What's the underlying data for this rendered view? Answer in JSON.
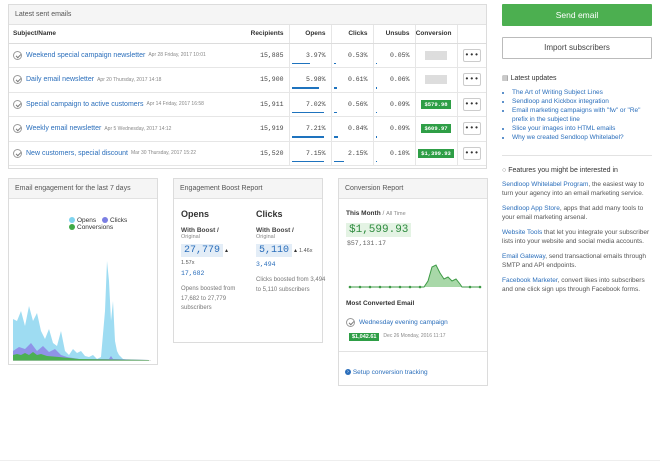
{
  "sent_panel": {
    "title": "Latest sent emails",
    "headers": [
      "Subject/Name",
      "Recipients",
      "Opens",
      "Clicks",
      "Unsubs",
      "Conversion"
    ],
    "rows": [
      {
        "name": "Weekend special campaign newsletter",
        "date": "Apr 28 Friday, 2017 10:01",
        "recipients": "15,885",
        "opens": "3.97%",
        "clicks": "0.53%",
        "unsubs": "0.05%",
        "conversion": "$0.00",
        "conv_zero": true,
        "opens_pct": 0.0397,
        "clicks_pct": 0.0053,
        "unsubs_pct": 0.0005
      },
      {
        "name": "Daily email newsletter",
        "date": "Apr 20 Thursday, 2017 14:18",
        "recipients": "15,900",
        "opens": "5.98%",
        "clicks": "0.61%",
        "unsubs": "0.06%",
        "conversion": "$0.00",
        "conv_zero": true,
        "opens_pct": 0.0598,
        "clicks_pct": 0.0061,
        "unsubs_pct": 0.0006
      },
      {
        "name": "Special campaign to active customers",
        "date": "Apr 14 Friday, 2017 16:58",
        "recipients": "15,911",
        "opens": "7.02%",
        "clicks": "0.56%",
        "unsubs": "0.09%",
        "conversion": "$579.98",
        "conv_zero": false,
        "opens_pct": 0.0702,
        "clicks_pct": 0.0056,
        "unsubs_pct": 0.0009
      },
      {
        "name": "Weekly email newsletter",
        "date": "Apr 5 Wednesday, 2017 14:12",
        "recipients": "15,919",
        "opens": "7.21%",
        "clicks": "0.84%",
        "unsubs": "0.09%",
        "conversion": "$609.97",
        "conv_zero": false,
        "opens_pct": 0.0721,
        "clicks_pct": 0.0084,
        "unsubs_pct": 0.0009
      },
      {
        "name": "New customers, special discount",
        "date": "Mar 30 Thursday, 2017 15:22",
        "recipients": "15,520",
        "opens": "7.15%",
        "clicks": "2.15%",
        "unsubs": "0.10%",
        "conversion": "$1,399.93",
        "conv_zero": false,
        "opens_pct": 0.0715,
        "clicks_pct": 0.0215,
        "unsubs_pct": 0.001
      }
    ],
    "more_label": "•••"
  },
  "engagement": {
    "title": "Email engagement for the last 7 days",
    "legend": {
      "opens": "Opens",
      "clicks": "Clicks",
      "conversions": "Conversions"
    },
    "colors": {
      "opens": "#7fd4ef",
      "clicks": "#7b7fe3",
      "conversions": "#3faa46"
    }
  },
  "boost": {
    "title": "Engagement Boost Report",
    "opens": {
      "title": "Opens",
      "with_boost": "With Boost",
      "original": "Original",
      "value": "27,779",
      "multiplier": "1.57x",
      "orig_value": "17,682",
      "note": "Opens boosted from 17,682 to 27,779 subscribers"
    },
    "clicks": {
      "title": "Clicks",
      "with_boost": "With Boost",
      "original": "Original",
      "value": "5,110",
      "multiplier": "1.46x",
      "orig_value": "3,494",
      "note": "Clicks boosted from 3,494 to 5,110 subscribers"
    }
  },
  "conversion": {
    "title": "Conversion Report",
    "this_month": "This Month",
    "all_time": "All Time",
    "amount": "$1,599.93",
    "all_time_amount": "$57,131.17",
    "most_converted_title": "Most Converted Email",
    "most_converted_name": "Wednesday evening campaign",
    "most_converted_value": "$1,042.61",
    "most_converted_date": "Dec 26 Monday, 2016 11:17",
    "setup_link": "Setup conversion tracking"
  },
  "sidebar": {
    "send_label": "Send email",
    "import_label": "Import subscribers",
    "updates_title": "Latest updates",
    "updates": [
      "The Art of Writing Subject Lines",
      "Sendloop and Kickbox integration",
      "Email marketing campaigns with \"fw\" or \"Re\" prefix in the subject line",
      "Slice your images into HTML emails",
      "Why we created Sendloop Whitelabel?"
    ],
    "features_title": "Features you might be interested in",
    "features": [
      {
        "link": "Sendloop Whitelabel Program",
        "text": ", the easiest way to turn your agency into an email marketing service."
      },
      {
        "link": "Sendloop App Store",
        "text": ", apps that add many tools to your email marketing arsenal."
      },
      {
        "link": "Website Tools",
        "text": " that let you integrate your subscriber lists into your website and social media accounts."
      },
      {
        "link": "Email Gateway",
        "text": ", send transactional emails through SMTP and API endpoints."
      },
      {
        "link": "Facebook Marketer",
        "text": ", convert likes into subscribers and one click sign ups through Facebook forms."
      }
    ]
  }
}
